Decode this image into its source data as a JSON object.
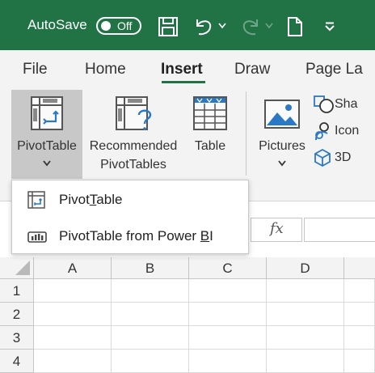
{
  "titlebar": {
    "autosave_label": "AutoSave",
    "toggle_state": "Off",
    "bg_color": "#217346",
    "icons": [
      "save-icon",
      "undo-icon",
      "redo-icon",
      "new-file-icon",
      "customize-toolbar-icon"
    ]
  },
  "tabs": [
    {
      "label": "File"
    },
    {
      "label": "Home"
    },
    {
      "label": "Insert",
      "active": true
    },
    {
      "label": "Draw"
    },
    {
      "label": "Page La"
    }
  ],
  "ribbon": {
    "pivottable_label": "PivotTable",
    "recommended_line1": "Recommended",
    "recommended_line2": "PivotTables",
    "table_label": "Table",
    "pictures_label": "Pictures",
    "shapes_label": "Sha",
    "icons_label": "Icon",
    "models_label": "3D"
  },
  "dropdown": {
    "items": [
      {
        "pre": "Pivot",
        "underline": "T",
        "post": "able",
        "icon": "pivottable-icon"
      },
      {
        "pre": "PivotTable from Power ",
        "underline": "B",
        "post": "I",
        "icon": "power-bi-icon"
      }
    ]
  },
  "formula_bar": {
    "fx_label": "fx"
  },
  "grid": {
    "columns": [
      "A",
      "B",
      "C",
      "D"
    ],
    "rows": [
      "1",
      "2",
      "3",
      "4"
    ]
  },
  "accent_color": "#217346"
}
